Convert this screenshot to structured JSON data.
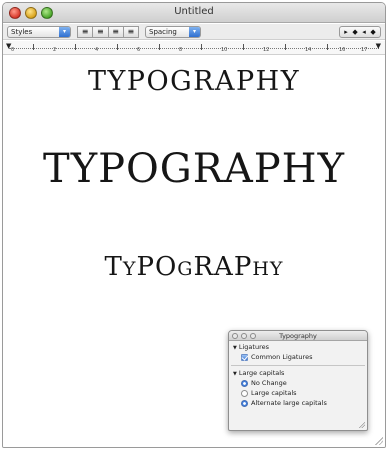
{
  "window": {
    "title": "Untitled"
  },
  "toolbar": {
    "styles_label": "Styles",
    "spacing_label": "Spacing",
    "alignment": [
      {
        "name": "align-left-button",
        "glyph": "≡"
      },
      {
        "name": "align-center-button",
        "glyph": "≡"
      },
      {
        "name": "align-justify-button",
        "glyph": "≡"
      },
      {
        "name": "align-right-button",
        "glyph": "≡"
      }
    ],
    "tab_stop_glyphs": [
      "▸",
      "◆",
      "◂",
      "◆"
    ]
  },
  "ruler": {
    "numbers": [
      "0",
      "2",
      "4",
      "6",
      "8",
      "10",
      "12",
      "14",
      "16",
      "17"
    ]
  },
  "document": {
    "line1": "TYPOGRAPHY",
    "line2": "TYPOGRAPHY",
    "line3": {
      "parts": [
        {
          "text": "T",
          "small": false
        },
        {
          "text": "Y",
          "small": true
        },
        {
          "text": "P",
          "small": false
        },
        {
          "text": "O",
          "small": false
        },
        {
          "text": "G",
          "small": true
        },
        {
          "text": "R",
          "small": false
        },
        {
          "text": "A",
          "small": false
        },
        {
          "text": "P",
          "small": false
        },
        {
          "text": "H",
          "small": true
        },
        {
          "text": "Y",
          "small": true
        }
      ]
    }
  },
  "palette": {
    "title": "Typography",
    "ligatures_header": "Ligatures",
    "common_ligatures": "Common Ligatures",
    "large_capitals_header": "Large capitals",
    "options": [
      {
        "label": "No Change",
        "selected": true
      },
      {
        "label": "Large capitals",
        "selected": false
      },
      {
        "label": "Alternate large capitals",
        "selected": true
      }
    ]
  },
  "colors": {
    "accent": "#3d7ad6",
    "text": "#161616"
  }
}
